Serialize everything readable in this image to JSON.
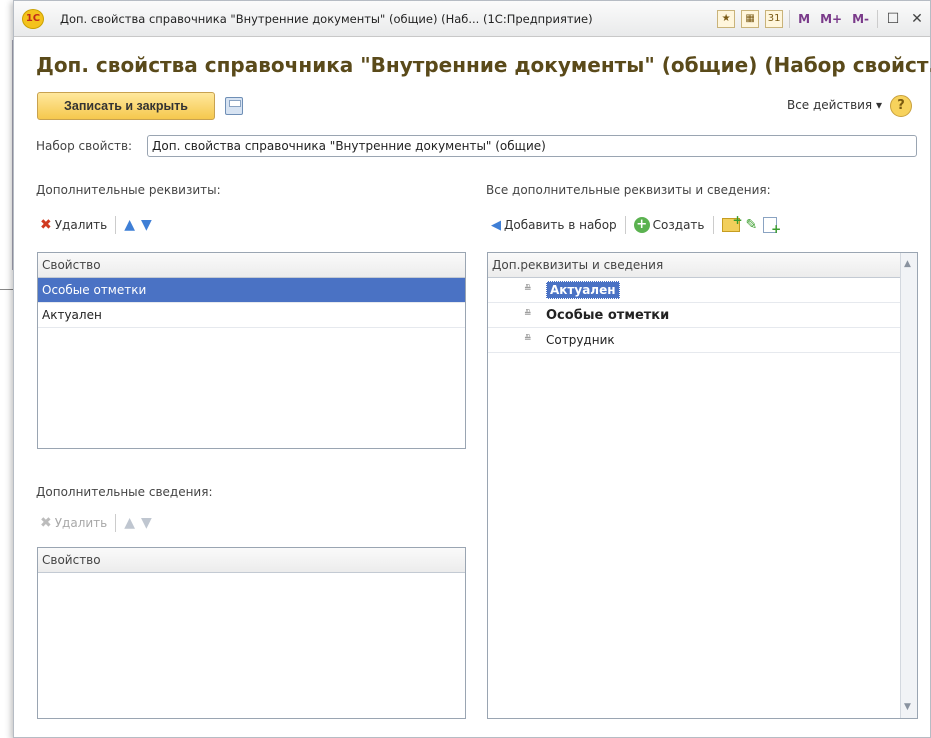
{
  "window": {
    "logo": "1С",
    "title": "Доп. свойства справочника \"Внутренние документы\" (общие) (Наб...  (1С:Предприятие)",
    "buttons": {
      "m": "M",
      "m_plus": "M+",
      "m_minus": "M-",
      "calendar": "31"
    }
  },
  "form": {
    "title": "Доп. свойства справочника \"Внутренние документы\" (общие) (Набор свойст...",
    "save_close_label": "Записать и закрыть",
    "all_actions_label": "Все действия ▾",
    "help_label": "?",
    "set_label": "Набор свойств:",
    "set_value": "Доп. свойства справочника \"Внутренние документы\" (общие)"
  },
  "left": {
    "req_label": "Дополнительные реквизиты:",
    "req_toolbar": {
      "delete": "Удалить"
    },
    "req_grid": {
      "header": "Свойство",
      "rows": [
        "Особые отметки",
        "Актуален"
      ]
    },
    "info_label": "Дополнительные сведения:",
    "info_toolbar": {
      "delete": "Удалить"
    },
    "info_grid": {
      "header": "Свойство"
    }
  },
  "right": {
    "label": "Все дополнительные реквизиты и сведения:",
    "toolbar": {
      "add_to_set": "Добавить в набор",
      "create": "Создать"
    },
    "grid": {
      "header": "Доп.реквизиты и сведения",
      "rows": [
        {
          "text": "Актуален"
        },
        {
          "text": "Особые отметки"
        },
        {
          "text": "Сотрудник"
        }
      ]
    }
  }
}
